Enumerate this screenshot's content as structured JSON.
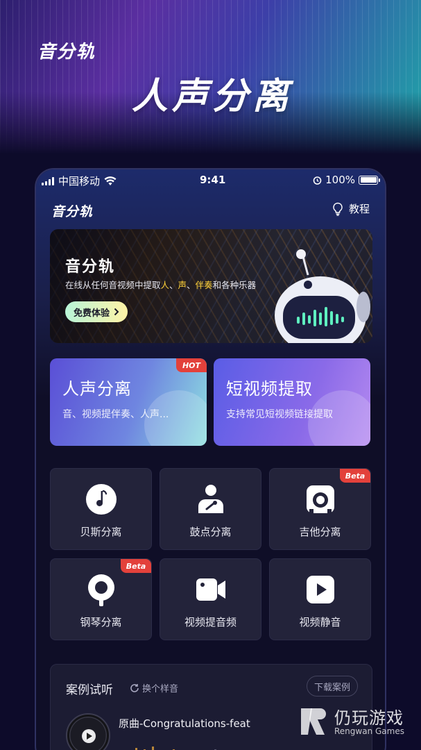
{
  "promo": {
    "brand": "音分轨",
    "headline": "人声分离"
  },
  "status_bar": {
    "carrier": "中国移动",
    "time": "9:41",
    "battery": "100%",
    "icons": [
      "signal-icon",
      "wifi-icon",
      "alarm-icon",
      "battery-icon"
    ]
  },
  "header": {
    "app_title": "音分轨",
    "tutorial_label": "教程",
    "tutorial_icon": "lightbulb-icon"
  },
  "banner": {
    "title": "音分轨",
    "subtitle_pre": "在线从任何音视频中提取",
    "hl1": "人",
    "sep1": "、",
    "hl2": "声",
    "sep2": "、",
    "hl3": "伴奏",
    "subtitle_post": "和各种乐器",
    "cta": "免费体验",
    "highlight_color": "#ffd23a"
  },
  "features": [
    {
      "title": "人声分离",
      "subtitle": "音、视频提伴奏、人声...",
      "badge": "HOT"
    },
    {
      "title": "短视频提取",
      "subtitle": "支持常见短视频链接提取"
    }
  ],
  "tools": [
    {
      "label": "贝斯分离",
      "icon": "music-note-icon"
    },
    {
      "label": "鼓点分离",
      "icon": "drummer-icon"
    },
    {
      "label": "吉他分离",
      "icon": "guitar-amp-icon",
      "badge": "Beta"
    },
    {
      "label": "钢琴分离",
      "icon": "piano-pin-icon",
      "badge": "Beta"
    },
    {
      "label": "视频提音频",
      "icon": "video-camera-icon"
    },
    {
      "label": "视频静音",
      "icon": "video-play-icon"
    }
  ],
  "samples": {
    "title": "案例试听",
    "swap_label": "换个样音",
    "download_label": "下载案例",
    "song_title": "原曲-Congratulations-feat"
  },
  "watermark": {
    "name": "仍玩游戏",
    "sub": "Rengwan Games"
  },
  "colors": {
    "accent_red": "#e3413b",
    "background": "#0d0b2a",
    "tile": "#23233a"
  }
}
